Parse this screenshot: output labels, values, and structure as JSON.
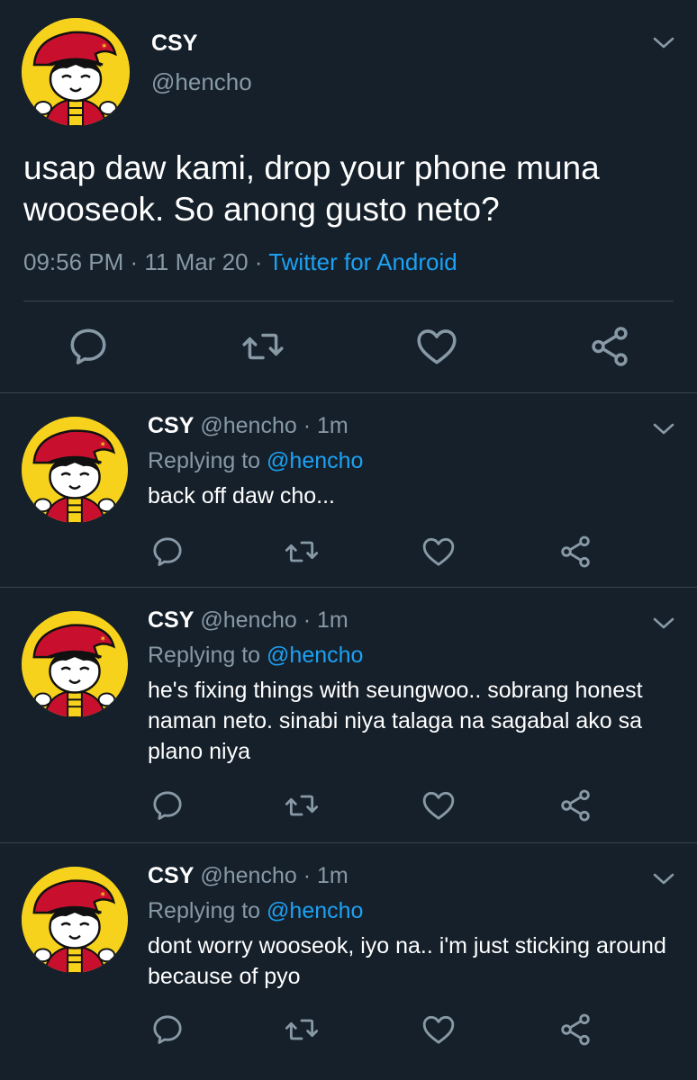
{
  "main_tweet": {
    "display_name": "CSY",
    "handle": "@hencho",
    "text": "usap daw kami, drop your phone muna wooseok. So anong gusto neto?",
    "time": "09:56 PM",
    "sep1": " · ",
    "date": "11 Mar 20",
    "sep2": " · ",
    "source": "Twitter for Android"
  },
  "replies": [
    {
      "display_name": "CSY",
      "handle": "@hencho",
      "dot": "·",
      "time": "1m",
      "replying_prefix": "Replying to ",
      "replying_to": "@hencho",
      "text": "back off daw cho..."
    },
    {
      "display_name": "CSY",
      "handle": "@hencho",
      "dot": "·",
      "time": "1m",
      "replying_prefix": "Replying to ",
      "replying_to": "@hencho",
      "text": "he's fixing things with seungwoo.. sobrang honest naman neto. sinabi niya talaga na sagabal ako sa plano niya"
    },
    {
      "display_name": "CSY",
      "handle": "@hencho",
      "dot": "·",
      "time": "1m",
      "replying_prefix": "Replying to ",
      "replying_to": "@hencho",
      "text": "dont worry wooseok, iyo na.. i'm just sticking around because of pyo"
    }
  ],
  "icons": {
    "reply": "comment-icon",
    "retweet": "retweet-icon",
    "like": "heart-icon",
    "share": "share-icon",
    "menu": "chevron-down-icon"
  },
  "colors": {
    "background": "#15202b",
    "muted_text": "#8899a6",
    "link": "#1da1f2",
    "divider": "#38444d",
    "avatar_bg": "#f6d21c"
  }
}
